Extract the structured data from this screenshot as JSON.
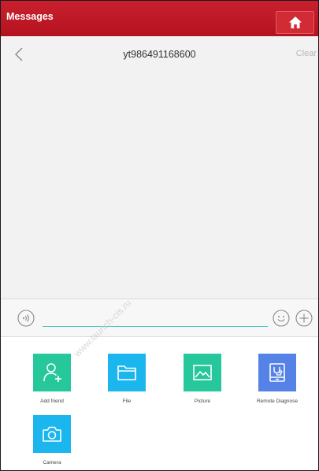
{
  "app": {
    "title": "Messages"
  },
  "chat": {
    "title": "yt986491168600",
    "clear_label": "Clear"
  },
  "input": {
    "value": "",
    "placeholder": ""
  },
  "panel": {
    "items": [
      {
        "label": "Add friend",
        "icon": "add-friend-icon",
        "color": "#25c79b"
      },
      {
        "label": "File",
        "icon": "folder-icon",
        "color": "#1cb6ee"
      },
      {
        "label": "Picture",
        "icon": "picture-icon",
        "color": "#25c79b"
      },
      {
        "label": "Remote Diagnose",
        "icon": "remote-diagnose-icon",
        "color": "#5582e6"
      },
      {
        "label": "Camera",
        "icon": "camera-icon",
        "color": "#1cb6ee"
      }
    ]
  },
  "watermark": "www.launch-cis.ru",
  "colors": {
    "header_red": "#c01826",
    "input_underline": "#4fc3c9"
  }
}
